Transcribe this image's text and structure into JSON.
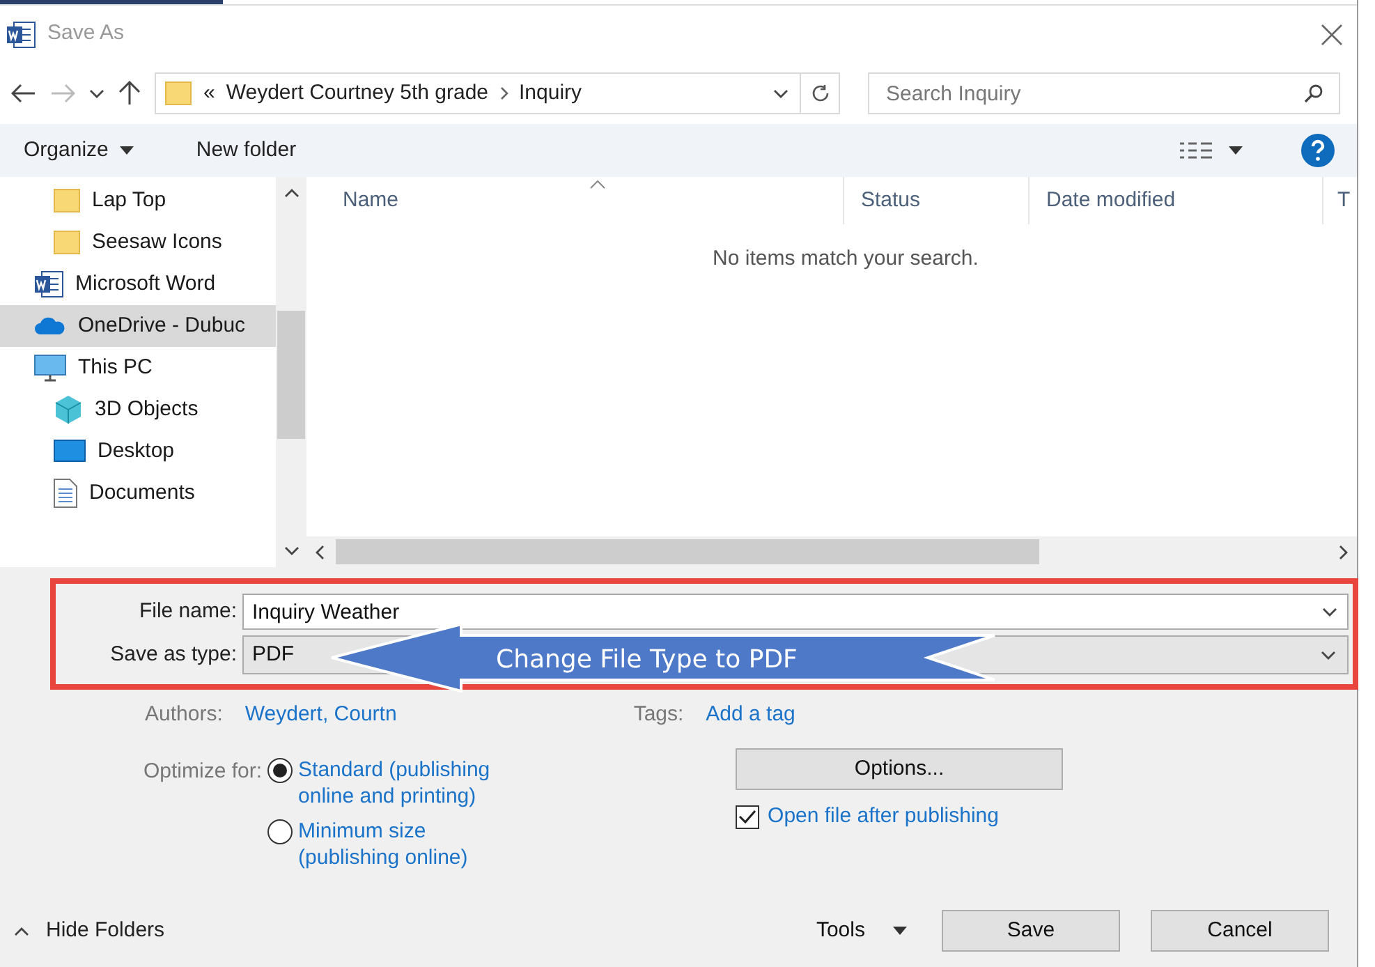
{
  "window": {
    "title": "Save As"
  },
  "address": {
    "overflow": "«",
    "path": [
      "Weydert Courtney 5th grade",
      "Inquiry"
    ]
  },
  "search": {
    "placeholder": "Search Inquiry"
  },
  "toolbar": {
    "organize": "Organize",
    "new_folder": "New folder"
  },
  "sidebar": {
    "items": [
      {
        "kind": "folder",
        "label": "Lap Top",
        "selected": false
      },
      {
        "kind": "folder",
        "label": "Seesaw Icons",
        "selected": false
      },
      {
        "kind": "word",
        "label": "Microsoft Word",
        "selected": false
      },
      {
        "kind": "cloud",
        "label": "OneDrive - Dubuc",
        "selected": true
      },
      {
        "kind": "pc",
        "label": "This PC",
        "selected": false,
        "children": [
          {
            "kind": "cube",
            "label": "3D Objects",
            "selected": false
          },
          {
            "kind": "desktop",
            "label": "Desktop",
            "selected": false
          },
          {
            "kind": "document",
            "label": "Documents",
            "selected": false
          }
        ]
      }
    ]
  },
  "file_list": {
    "columns": [
      "Name",
      "Status",
      "Date modified",
      "T"
    ],
    "empty_message": "No items match your search."
  },
  "form": {
    "file_name": {
      "label": "File name:",
      "value": "Inquiry Weather"
    },
    "save_as_type": {
      "label": "Save as type:",
      "value": "PDF"
    },
    "authors": {
      "label": "Authors:",
      "value": "Weydert, Courtn"
    },
    "tags": {
      "label": "Tags:",
      "value": "Add a tag"
    }
  },
  "callout": {
    "text": "Change File Type to PDF"
  },
  "optimize": {
    "label": "Optimize for:",
    "options": [
      {
        "label": "Standard (publishing online and printing)",
        "selected": true
      },
      {
        "label": "Minimum size (publishing online)",
        "selected": false
      }
    ]
  },
  "options_button": "Options...",
  "open_after": {
    "label": "Open file after publishing",
    "checked": true
  },
  "hide_folders": "Hide Folders",
  "tools": "Tools",
  "buttons": {
    "save": "Save",
    "cancel": "Cancel"
  }
}
